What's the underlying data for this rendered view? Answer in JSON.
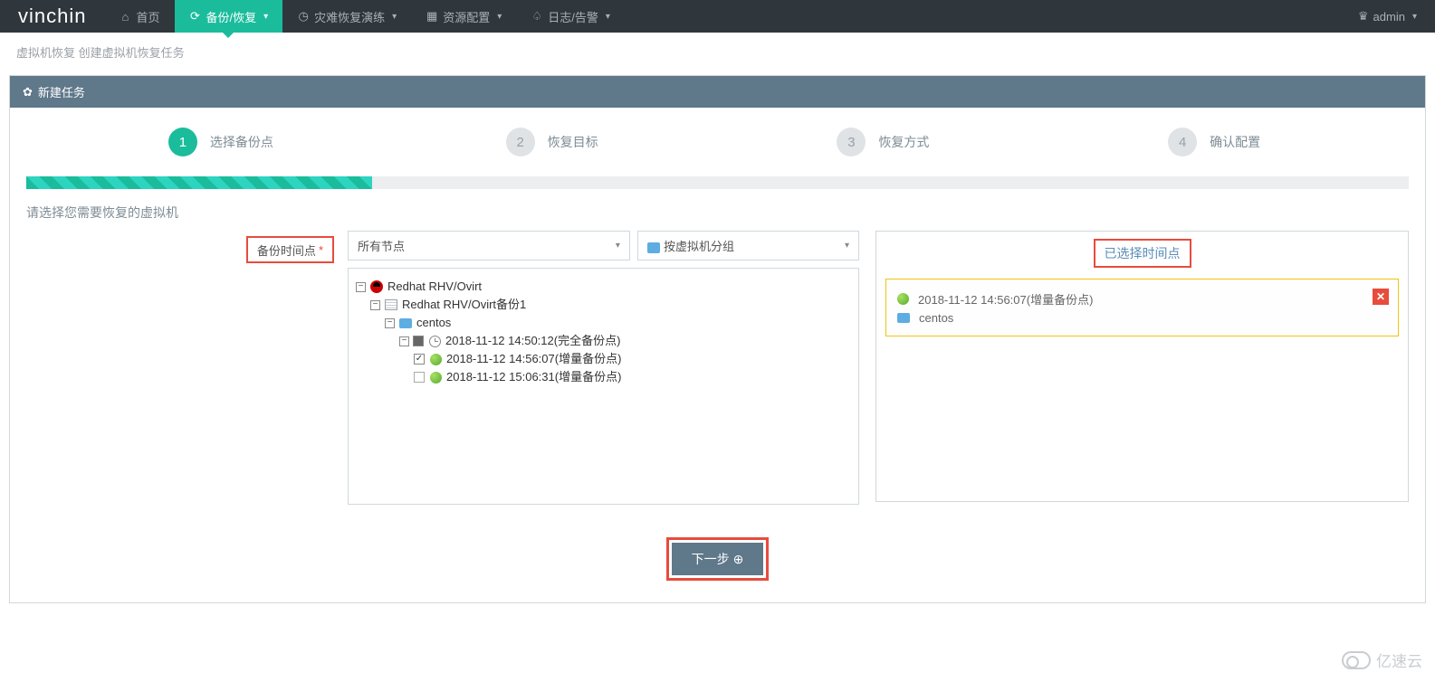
{
  "brand": "vinchin",
  "nav": {
    "home": "首页",
    "backup": "备份/恢复",
    "drill": "灾难恢复演练",
    "resources": "资源配置",
    "logs": "日志/告警"
  },
  "user": "admin",
  "breadcrumb": "虚拟机恢复 创建虚拟机恢复任务",
  "panel_title": "新建任务",
  "steps": [
    {
      "num": "1",
      "label": "选择备份点"
    },
    {
      "num": "2",
      "label": "恢复目标"
    },
    {
      "num": "3",
      "label": "恢复方式"
    },
    {
      "num": "4",
      "label": "确认配置"
    }
  ],
  "instruction": "请选择您需要恢复的虚拟机",
  "backup_point_label": "备份时间点",
  "select_node": "所有节点",
  "select_group": "按虚拟机分组",
  "tree": {
    "root": "Redhat RHV/Ovirt",
    "job": "Redhat RHV/Ovirt备份1",
    "vm": "centos",
    "full": "2018-11-12 14:50:12(完全备份点)",
    "inc1": "2018-11-12 14:56:07(增量备份点)",
    "inc2": "2018-11-12 15:06:31(增量备份点)"
  },
  "selected_header": "已选择时间点",
  "selected": {
    "time": "2018-11-12 14:56:07(增量备份点)",
    "vm": "centos"
  },
  "next_btn": "下一步",
  "watermark": "亿速云"
}
